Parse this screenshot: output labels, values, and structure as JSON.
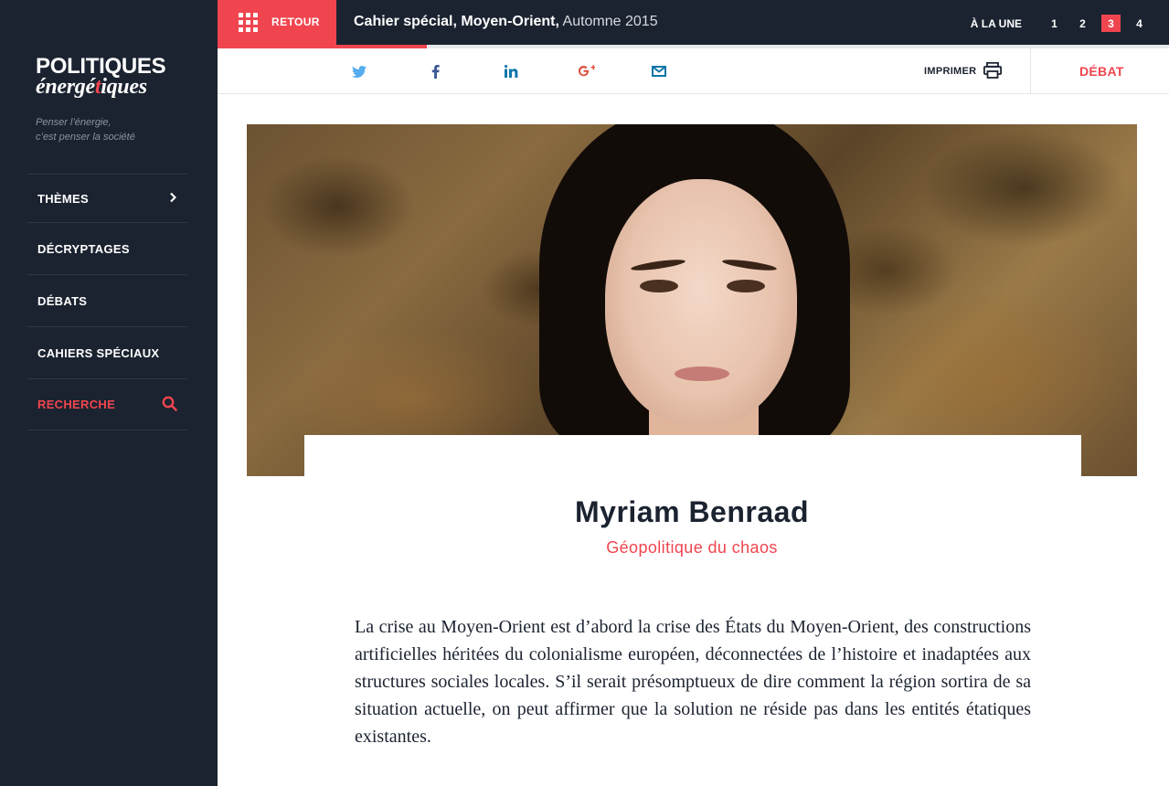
{
  "brand": {
    "line1": "POLITIQUES",
    "line2_pre": "énergé",
    "line2_accent": "t",
    "line2_post": "iques",
    "tagline_1": "Penser l’énergie,",
    "tagline_2": "c’est penser la société"
  },
  "sidebar": {
    "items": [
      {
        "label": "THÈMES",
        "icon": "chevron-right-icon"
      },
      {
        "label": "DÉCRYPTAGES"
      },
      {
        "label": "DÉBATS"
      },
      {
        "label": "CAHIERS SPÉCIAUX"
      },
      {
        "label": "RECHERCHE",
        "icon": "search-icon"
      }
    ]
  },
  "topbar": {
    "back_label": "RETOUR",
    "crumb_bold": "Cahier spécial, Moyen-Orient,",
    "crumb_light": "Automne 2015",
    "a_la_une": "À LA UNE",
    "pages": [
      "1",
      "2",
      "3",
      "4"
    ],
    "active_page": "3"
  },
  "progress": {
    "fraction": 0.22
  },
  "sharebar": {
    "icons": [
      "twitter-icon",
      "facebook-icon",
      "linkedin-icon",
      "google-plus-icon",
      "email-icon"
    ],
    "print_label": "IMPRIMER",
    "debat_label": "DÉBAT"
  },
  "article": {
    "author": "Myriam Benraad",
    "subtitle": "Géopolitique du chaos",
    "lead": "La crise au Moyen-Orient est d’abord la crise des États du Moyen-Orient, des constructions artificielles héritées du colonialisme européen, déconnectées de l’histoire et inadaptées aux structures sociales locales. S’il serait présomptueux de dire comment la région sortira de sa situation actuelle, on peut affirmer que la solution ne réside pas dans les entités étatiques existantes."
  },
  "colors": {
    "navy": "#1b2330",
    "accent": "#f0454f",
    "social_blue": "#55acee"
  }
}
